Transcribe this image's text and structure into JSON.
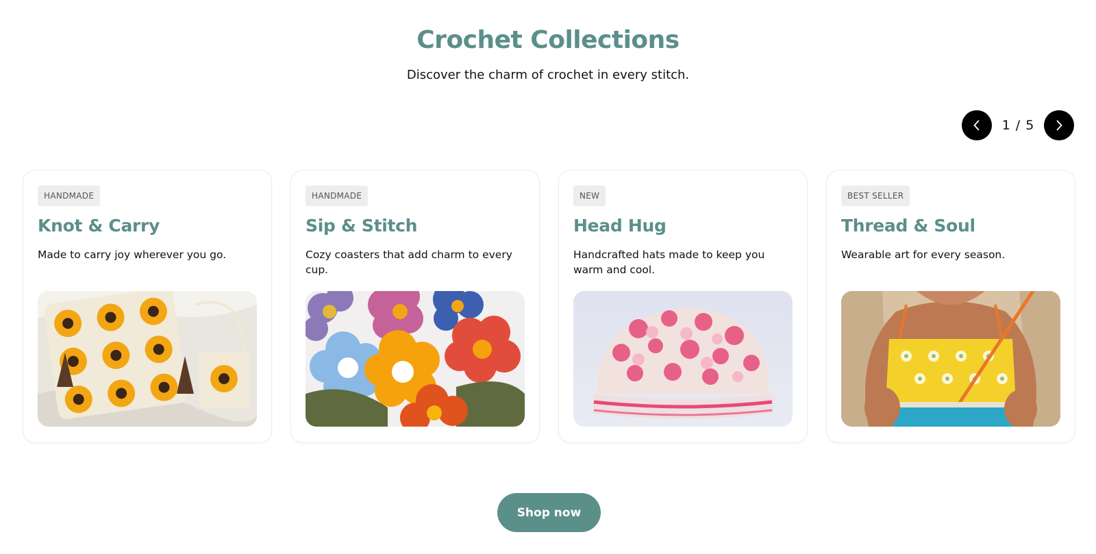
{
  "theme": {
    "accent": "#5b8f8a",
    "dark": "#000000"
  },
  "header": {
    "title": "Crochet Collections",
    "subtitle": "Discover the charm of crochet in every stitch."
  },
  "pager": {
    "current": "1",
    "separator": "/",
    "total": "5",
    "prev_icon": "chevron-left-icon",
    "next_icon": "chevron-right-icon"
  },
  "cards": [
    {
      "badge": "HANDMADE",
      "title": "Knot & Carry",
      "description": "Made to carry joy wherever you go.",
      "image": "sunflower-crochet-bags-image"
    },
    {
      "badge": "HANDMADE",
      "title": "Sip & Stitch",
      "description": "Cozy coasters that add charm to every cup.",
      "image": "crochet-flower-coasters-image"
    },
    {
      "badge": "NEW",
      "title": "Head Hug",
      "description": "Handcrafted hats made to keep you warm and cool.",
      "image": "pink-crochet-hat-image"
    },
    {
      "badge": "BEST SELLER",
      "title": "Thread & Soul",
      "description": "Wearable art for every season.",
      "image": "yellow-crochet-top-image"
    }
  ],
  "cta": {
    "label": "Shop now"
  }
}
